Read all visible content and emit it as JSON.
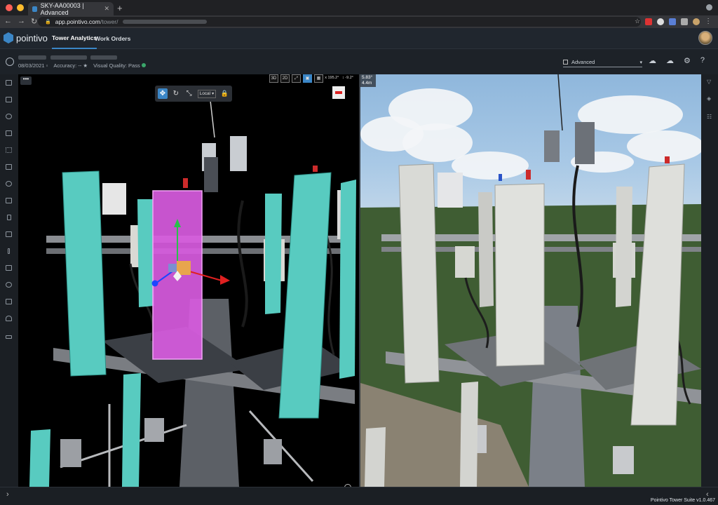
{
  "browser": {
    "tab_title": "SKY-AA00003 | Advanced",
    "tab_close": "✕",
    "new_tab": "+",
    "url_host": "app.pointivo.com",
    "url_path": "/tower/"
  },
  "app": {
    "logo_text": "pointivo",
    "nav_tabs": [
      {
        "label": "Tower Analytics",
        "active": true
      },
      {
        "label": "Work Orders",
        "active": false
      }
    ]
  },
  "subheader": {
    "date": "08/03/2021",
    "accuracy": "Accuracy: --",
    "visual_quality": "Visual Quality: Pass",
    "mode_label": "Advanced"
  },
  "viewer_left": {
    "more_label": "•••",
    "view_buttons": [
      {
        "label": "3D",
        "active": false
      },
      {
        "label": "2D",
        "active": false
      },
      {
        "label": "⤢",
        "active": false
      },
      {
        "label": "▣",
        "active": true
      },
      {
        "label": "▦",
        "active": false
      }
    ],
    "coordinates": [
      "x 195.2°",
      "↕ -9.2°"
    ],
    "gizmo": {
      "select_value": "Local"
    }
  },
  "viewer_right": {
    "angle": "5.83°",
    "distance": "4.4m"
  },
  "footer": {
    "brand": "Pointivo Tower Suite v1.0.467"
  },
  "colors": {
    "accent": "#3b86c6",
    "antenna_highlight": "#d85be0",
    "antenna_teal": "#58cbc0",
    "gizmo_green": "#29c04a",
    "gizmo_red": "#e02020",
    "gizmo_blue": "#1e45ff"
  }
}
